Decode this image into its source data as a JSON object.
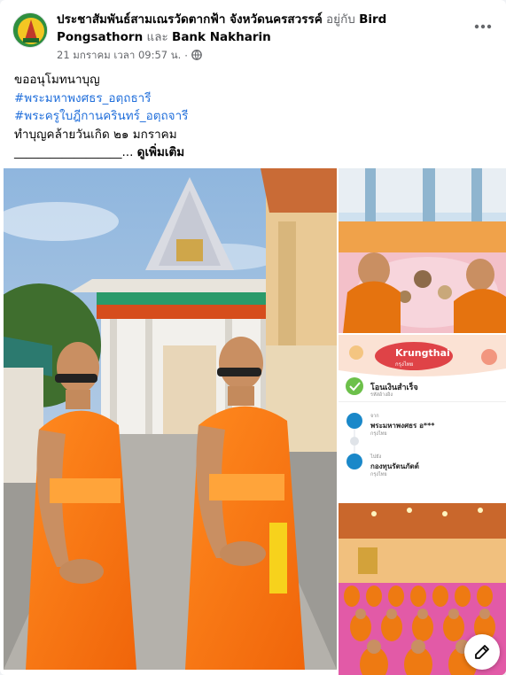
{
  "post": {
    "page_name": "ประชาสัมพันธ์สามเณรวัดตากฟ้า จังหวัดนครสวรรค์",
    "with_word": "อยู่กับ",
    "tagged_1": "Bird Pongsathorn",
    "and_word": "และ",
    "tagged_2": "Bank Nakharin",
    "timestamp": "21 มกราคม เวลา 09:57 น.",
    "separator": "·",
    "audience_icon": "globe-icon",
    "more_icon": "more-horizontal-icon",
    "lines": {
      "line1": "ขออนุโมทนาบุญ",
      "hashtag1": "#พระมหาพงศธร_อตฺถธารี",
      "hashtag2": "#พระครูใบฎีกานครินทร์_อตฺถจารี",
      "line4": "ทำบุญคล้ายวันเกิด ๒๑ มกราคม",
      "line5_prefix": "__________________...",
      "see_more": "ดูเพิ่มเติม"
    }
  },
  "receipt": {
    "brand": "Krungthai",
    "brand_sub": "กรุงไทย",
    "status": "โอนเงินสำเร็จ",
    "status_sub": "รหัสอ้างอิง",
    "from_label": "จาก",
    "from_name": "พระมหาพงศธร อ***",
    "from_bank": "กรุงไทย",
    "to_label": "ไปยัง",
    "to_name": "กองทุนรัตนภัตต์",
    "to_bank": "กรุงไทย",
    "accent_color": "#00a6e6"
  },
  "compose_icon": "edit-icon"
}
